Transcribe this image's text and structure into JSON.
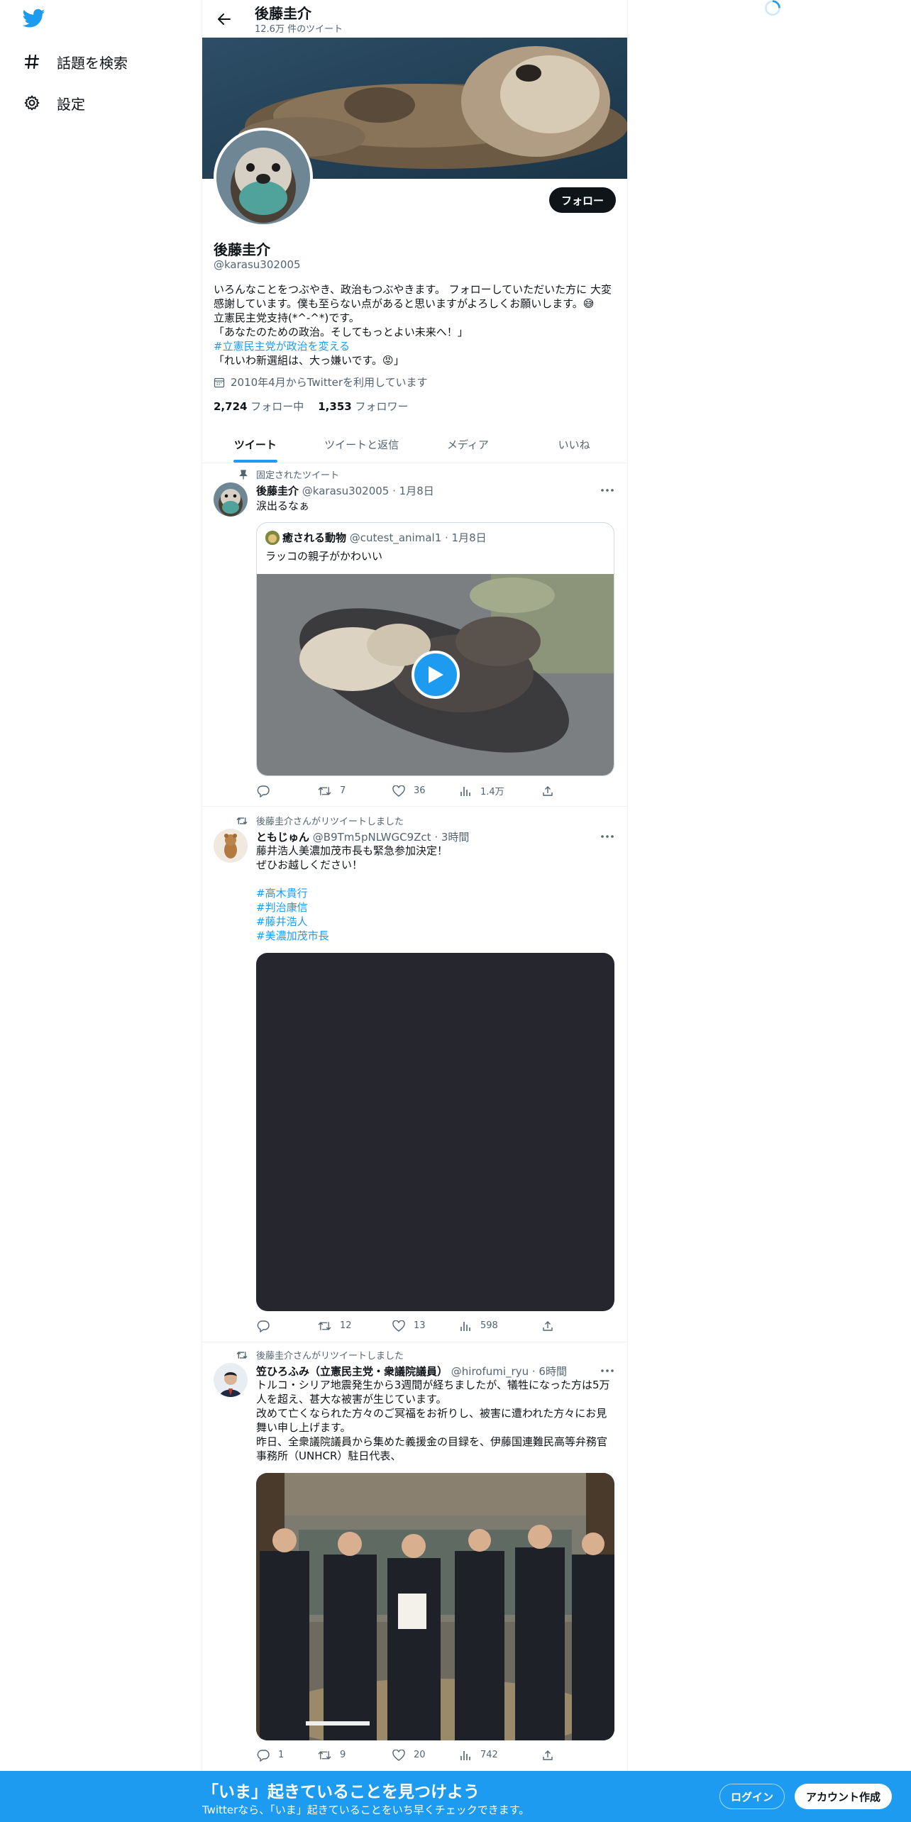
{
  "nav": {
    "explore_label": "話題を検索",
    "settings_label": "設定"
  },
  "header": {
    "title": "後藤圭介",
    "subtitle": "12.6万 件のツイート"
  },
  "profile": {
    "name": "後藤圭介",
    "handle": "@karasu302005",
    "follow_label": "フォロー",
    "bio_lines": [
      "いろんなことをつぶやき、政治もつぶやきます。 フォローしていただいた方に 大変",
      "感謝しています。僕も至らない点があると思いますがよろしくお願いします。😅",
      "立憲民主党支持(*^-^*)です。",
      "「あなたのための政治。そしてもっとよい未来へ！」"
    ],
    "bio_hashtag": "#立憲民主党が政治を変える",
    "bio_last_line": "「れいわ新選組は、大っ嫌いです。😡」",
    "joined": "2010年4月からTwitterを利用しています",
    "following_count": "2,724",
    "following_label": "フォロー中",
    "followers_count": "1,353",
    "followers_label": "フォロワー"
  },
  "tabs": [
    {
      "label": "ツイート"
    },
    {
      "label": "ツイートと返信"
    },
    {
      "label": "メディア"
    },
    {
      "label": "いいね"
    }
  ],
  "tweets": [
    {
      "context": "固定されたツイート",
      "name": "後藤圭介",
      "meta": "@karasu302005 · 1月8日",
      "text_lines": [
        "涙出るなぁ"
      ],
      "quote": {
        "name": "癒される動物",
        "meta": "@cutest_animal1 · 1月8日",
        "text": "ラッコの親子がかわいい"
      },
      "replies": "",
      "retweets": "7",
      "likes": "36",
      "views": "1.4万"
    },
    {
      "context": "後藤圭介さんがリツイートしました",
      "name": "ともじゅん",
      "meta": "@B9Tm5pNLWGC9Zct · 3時間",
      "text_lines": [
        "藤井浩人美濃加茂市長も緊急参加決定！",
        "ぜひお越しください！"
      ],
      "hashtags": [
        "#高木貴行",
        "#判治康信",
        "#藤井浩人",
        "#美濃加茂市長"
      ],
      "replies": "",
      "retweets": "12",
      "likes": "13",
      "views": "598"
    },
    {
      "context": "後藤圭介さんがリツイートしました",
      "name": "笠ひろふみ（立憲民主党・衆議院議員）",
      "meta": "@hirofumi_ryu · 6時間",
      "text_lines": [
        "トルコ・シリア地震発生から3週間が経ちましたが、犠牲になった方は5万",
        "人を超え、甚大な被害が生じています。",
        "改めて亡くなられた方々のご冥福をお祈りし、被害に遭われた方々にお見",
        "舞い申し上げます。",
        "昨日、全衆議院議員から集めた義援金の目録を、伊藤国連難民高等弁務官",
        "事務所（UNHCR）駐日代表、"
      ],
      "replies": "1",
      "retweets": "9",
      "likes": "20",
      "views": "742"
    }
  ],
  "bottom_bar": {
    "title": "「いま」起きていることを見つけよう",
    "subtitle": "Twitterなら、「いま」起きていることをいち早くチェックできます。",
    "login_label": "ログイン",
    "signup_label": "アカウント作成"
  },
  "colors": {
    "accent": "#1d9bf0",
    "text": "#0f1419",
    "secondary": "#536471"
  },
  "icons": [
    "twitter-logo-icon",
    "hashtag-icon",
    "gear-icon",
    "back-arrow-icon",
    "pin-icon",
    "retweet-icon",
    "reply-icon",
    "like-icon",
    "views-icon",
    "share-icon",
    "more-icon",
    "calendar-icon",
    "play-icon"
  ]
}
